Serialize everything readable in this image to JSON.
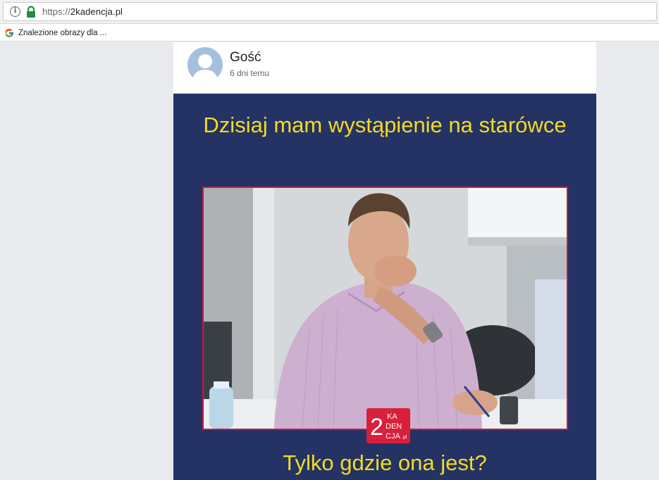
{
  "browser": {
    "url_scheme": "https://",
    "url_host": "2kadencja.pl"
  },
  "bookmarks": {
    "items": [
      {
        "label": "Znalezione obrazy dla ...",
        "icon": "google-icon"
      }
    ]
  },
  "post": {
    "author": "Gość",
    "timestamp": "6 dni temu",
    "meme": {
      "top_text": "Dzisiaj mam wystąpienie na starówce",
      "bottom_text": "Tylko gdzie ona jest?",
      "logo": {
        "number": "2",
        "line1": "KA",
        "line2": "DEN",
        "line3": "CJA",
        "suffix": ".pl"
      }
    }
  },
  "colors": {
    "meme_background": "#243264",
    "meme_text": "#f4dc1e",
    "photo_border": "#c8193c",
    "logo_red": "#d8203a",
    "lock_green": "#1e8e3e"
  }
}
